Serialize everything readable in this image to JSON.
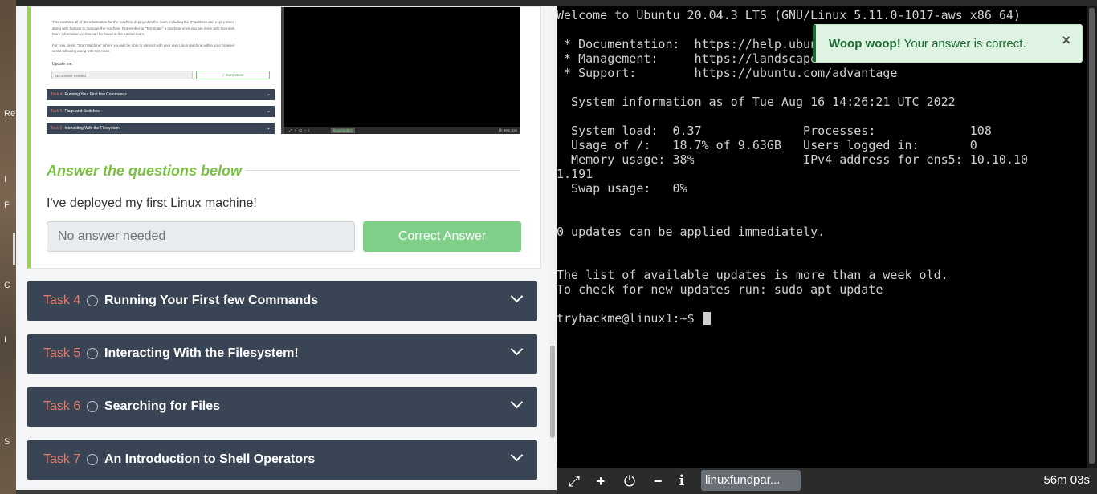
{
  "desktop": {
    "chars": [
      "Re",
      "I",
      "F",
      "C",
      "I",
      "S"
    ]
  },
  "preview": {
    "text_lines": [
      "This contains all of the information for the machine deployed in the room including the IP address and expiry timer -",
      "along with buttons to manage the machine. Remember to \"Terminate\" a machine once you are done with the room.",
      "More information on this can be found in the tutorial room.",
      "",
      "For now, press \"Start Machine\" where you will be able to interact with your own Linux machine within your browser",
      "whilst following along with this room."
    ],
    "update_label": "Update me.",
    "input_value": "No answer needed",
    "button_label": "✓ Completed",
    "tasks": [
      {
        "num": "Task 4",
        "title": "Running Your First few Commands"
      },
      {
        "num": "Task 5",
        "title": "Flags and Switches"
      },
      {
        "num": "Task 6",
        "title": "Interacting With the Filesystem!"
      }
    ],
    "term_tag": "linuxfundpt1",
    "term_time": "1h 58m 02s"
  },
  "answers": {
    "heading": "Answer the questions below",
    "question": "I've deployed my first Linux machine!",
    "input_value": "No answer needed",
    "button_label": "Correct Answer"
  },
  "tasks": [
    {
      "num": "Task 4",
      "title": "Running Your First few Commands"
    },
    {
      "num": "Task 5",
      "title": "Interacting With the Filesystem!"
    },
    {
      "num": "Task 6",
      "title": "Searching for Files"
    },
    {
      "num": "Task 7",
      "title": "An Introduction to Shell Operators"
    }
  ],
  "terminal": {
    "lines": [
      "Welcome to Ubuntu 20.04.3 LTS (GNU/Linux 5.11.0-1017-aws x86_64)",
      "",
      " * Documentation:  https://help.ubuntu.com",
      " * Management:     https://landscape.canonical.com",
      " * Support:        https://ubuntu.com/advantage",
      "",
      "  System information as of Tue Aug 16 14:26:21 UTC 2022",
      "",
      "  System load:  0.37              Processes:             108",
      "  Usage of /:   18.7% of 9.63GB   Users logged in:       0",
      "  Memory usage: 38%               IPv4 address for ens5: 10.10.10",
      "1.191",
      "  Swap usage:   0%",
      "",
      "",
      "0 updates can be applied immediately.",
      "",
      "",
      "The list of available updates is more than a week old.",
      "To check for new updates run: sudo apt update",
      ""
    ],
    "prompt": "tryhackme@linux1:~$ "
  },
  "terminal_bar": {
    "icons": [
      "expand-icon",
      "plus-icon",
      "power-icon",
      "minus-icon",
      "info-icon"
    ],
    "tag": "linuxfundpar...",
    "timer": "56m 03s"
  },
  "toast": {
    "title": "Woop woop!",
    "message": " Your answer is correct.",
    "close": "×"
  }
}
